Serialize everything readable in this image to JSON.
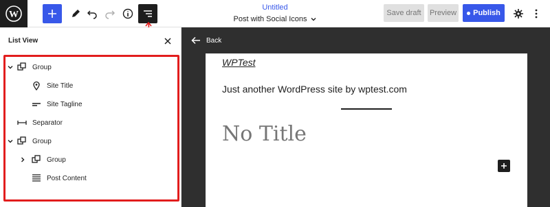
{
  "toolbar": {
    "doc_title": "Untitled",
    "doc_subtitle": "Post with Social Icons",
    "save_draft": "Save draft",
    "preview": "Preview",
    "publish": "Publish"
  },
  "list_view": {
    "title": "List View",
    "items": [
      {
        "label": "Group",
        "icon": "group-icon"
      },
      {
        "label": "Site Title",
        "icon": "map-pin-icon"
      },
      {
        "label": "Site Tagline",
        "icon": "tagline-icon"
      },
      {
        "label": "Separator",
        "icon": "separator-icon"
      },
      {
        "label": "Group",
        "icon": "group-icon"
      },
      {
        "label": "Group",
        "icon": "group-icon"
      },
      {
        "label": "Post Content",
        "icon": "post-content-icon"
      }
    ]
  },
  "canvas": {
    "back_label": "Back",
    "site_title": "WPTest",
    "tagline": "Just another WordPress site by wptest.com",
    "post_title": "No Title"
  },
  "colors": {
    "accent": "#3858e9",
    "highlight": "#e21d1d",
    "canvas_bg": "#2f2f2f"
  }
}
